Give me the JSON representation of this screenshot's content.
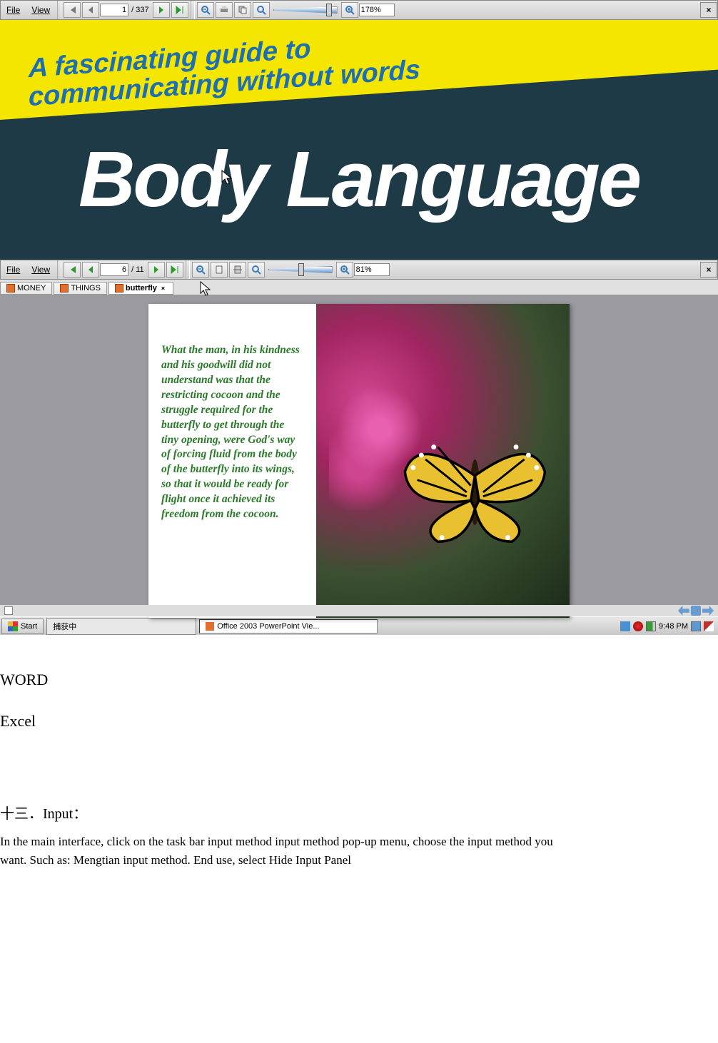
{
  "viewer1": {
    "menu": {
      "file": "File",
      "view": "View"
    },
    "page_current": "1",
    "page_total": "/ 337",
    "zoom": "178%",
    "close": "×",
    "content": {
      "subtitle_line1": "A fascinating guide to",
      "subtitle_line2": "communicating without words",
      "title": "Body Language"
    }
  },
  "viewer2": {
    "menu": {
      "file": "File",
      "view": "View"
    },
    "page_current": "6",
    "page_total": "/ 11",
    "zoom": "81%",
    "close": "×",
    "tabs": [
      {
        "label": "MONEY",
        "active": false
      },
      {
        "label": "THINGS",
        "active": false
      },
      {
        "label": "butterfly",
        "active": true
      }
    ],
    "tab_close": "×",
    "slide_text": "What the man, in his kindness and his goodwill did not understand was that the restricting cocoon and the struggle required for the butterfly to get through the tiny opening, were God's way of forcing fluid from the body of the butterfly into its wings, so that it would be ready for flight once it achieved its freedom from the cocoon."
  },
  "taskbar": {
    "start": "Start",
    "items": [
      {
        "label": "捕获中"
      },
      {
        "label": "Office 2003 PowerPoint Vie..."
      }
    ],
    "time": "9:48 PM"
  },
  "doc": {
    "word": "WORD",
    "excel": "Excel",
    "section_title": "十三．Input：",
    "section_body": "In the main interface, click on the task bar input method input method pop-up menu, choose the input method you want. Such as: Mengtian input method. End use, select Hide Input Panel"
  }
}
